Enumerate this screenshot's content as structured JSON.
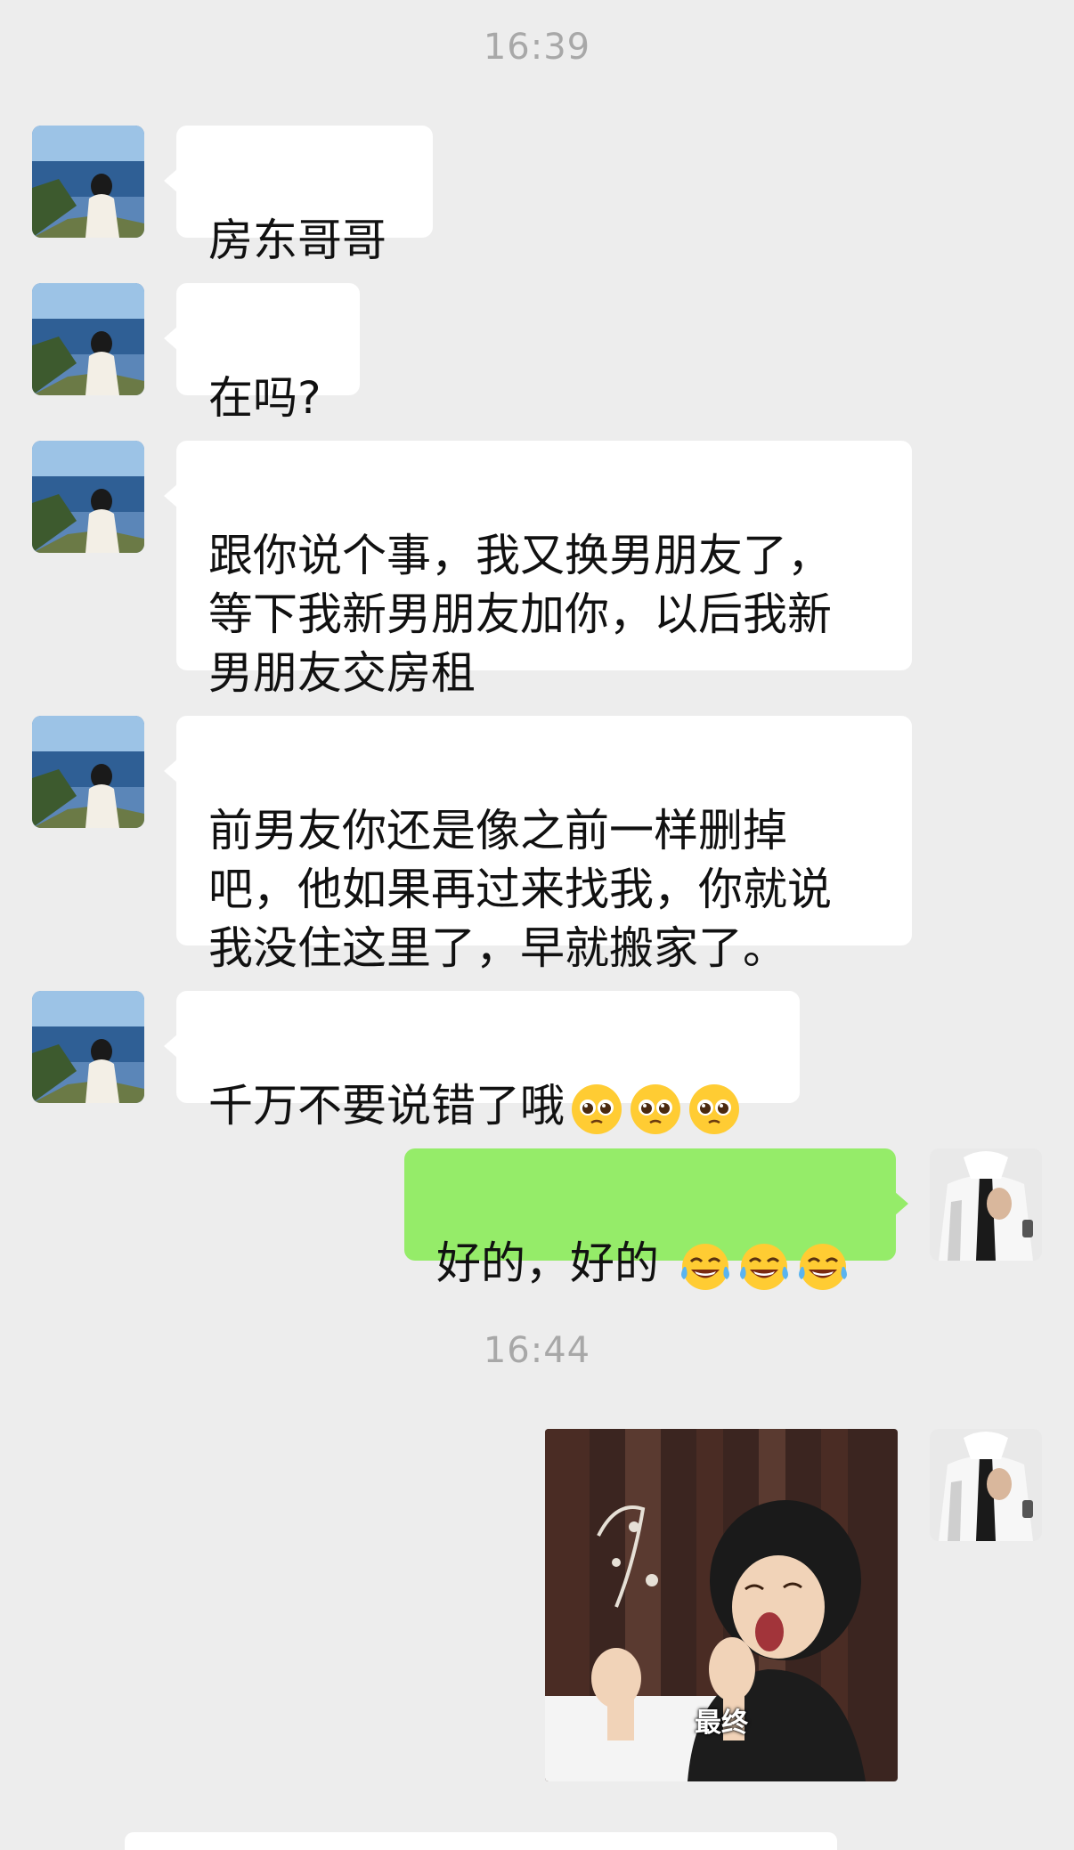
{
  "timestamps": [
    "16:39",
    "16:44"
  ],
  "messages": [
    {
      "side": "left",
      "text": "房东哥哥"
    },
    {
      "side": "left",
      "text": "在吗?"
    },
    {
      "side": "left",
      "text": "跟你说个事，我又换男朋友了，\n等下我新男朋友加你，以后我新\n男朋友交房租"
    },
    {
      "side": "left",
      "text": "前男友你还是像之前一样删掉\n吧，他如果再过来找我，你就说\n我没住这里了，早就搬家了。"
    },
    {
      "side": "left",
      "text": "千万不要说错了哦",
      "emoji": "pleading-face",
      "emoji_count": 3
    },
    {
      "side": "right",
      "text": "好的，好的 ",
      "emoji": "tears-of-joy",
      "emoji_count": 3
    },
    {
      "side": "right",
      "type": "sticker",
      "caption": "最终"
    }
  ],
  "colors": {
    "background": "#ededed",
    "bubble_left": "#ffffff",
    "bubble_right": "#95ec69",
    "timestamp": "#a8a8a8"
  }
}
